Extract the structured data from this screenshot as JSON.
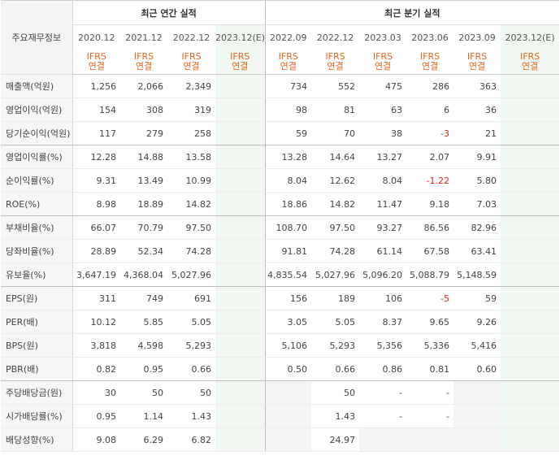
{
  "header": {
    "corner": "주요재무정보",
    "annual_title": "최근 연간 실적",
    "quarter_title": "최근 분기 실적",
    "periods": [
      "2020.12",
      "2021.12",
      "2022.12",
      "2023.12(E)",
      "2022.09",
      "2022.12",
      "2023.03",
      "2023.06",
      "2023.09",
      "2023.12(E)"
    ],
    "ifrs": "IFRS",
    "basis": "연결"
  },
  "rows": [
    {
      "label": "매출액(억원)",
      "values": [
        "1,256",
        "2,066",
        "2,349",
        "",
        "734",
        "552",
        "475",
        "286",
        "363",
        ""
      ]
    },
    {
      "label": "영업이익(억원)",
      "values": [
        "154",
        "308",
        "319",
        "",
        "98",
        "81",
        "63",
        "6",
        "36",
        ""
      ]
    },
    {
      "label": "당기순이익(억원)",
      "values": [
        "117",
        "279",
        "258",
        "",
        "59",
        "70",
        "38",
        "-3",
        "21",
        ""
      ]
    },
    {
      "label": "영업이익률(%)",
      "values": [
        "12.28",
        "14.88",
        "13.58",
        "",
        "13.28",
        "14.64",
        "13.27",
        "2.07",
        "9.91",
        ""
      ]
    },
    {
      "label": "순이익률(%)",
      "values": [
        "9.31",
        "13.49",
        "10.99",
        "",
        "8.04",
        "12.62",
        "8.04",
        "-1.22",
        "5.80",
        ""
      ]
    },
    {
      "label": "ROE(%)",
      "values": [
        "8.98",
        "18.89",
        "14.82",
        "",
        "18.86",
        "14.82",
        "11.47",
        "9.18",
        "7.03",
        ""
      ]
    },
    {
      "label": "부채비율(%)",
      "values": [
        "66.07",
        "70.79",
        "97.50",
        "",
        "108.70",
        "97.50",
        "93.27",
        "86.56",
        "82.96",
        ""
      ]
    },
    {
      "label": "당좌비율(%)",
      "values": [
        "28.89",
        "52.34",
        "74.28",
        "",
        "91.81",
        "74.28",
        "61.14",
        "67.58",
        "63.41",
        ""
      ]
    },
    {
      "label": "유보율(%)",
      "values": [
        "3,647.19",
        "4,368.04",
        "5,027.96",
        "",
        "4,835.54",
        "5,027.96",
        "5,096.20",
        "5,088.79",
        "5,148.59",
        ""
      ]
    },
    {
      "label": "EPS(원)",
      "values": [
        "311",
        "749",
        "691",
        "",
        "156",
        "189",
        "106",
        "-5",
        "59",
        ""
      ]
    },
    {
      "label": "PER(배)",
      "values": [
        "10.12",
        "5.85",
        "5.05",
        "",
        "3.05",
        "5.05",
        "8.37",
        "9.65",
        "9.26",
        ""
      ]
    },
    {
      "label": "BPS(원)",
      "values": [
        "3,818",
        "4,598",
        "5,293",
        "",
        "5,106",
        "5,293",
        "5,356",
        "5,336",
        "5,416",
        ""
      ]
    },
    {
      "label": "PBR(배)",
      "values": [
        "0.82",
        "0.95",
        "0.66",
        "",
        "0.50",
        "0.66",
        "0.86",
        "0.81",
        "0.60",
        ""
      ]
    },
    {
      "label": "주당배당금(원)",
      "values": [
        "30",
        "50",
        "50",
        "",
        "",
        "50",
        "-",
        "-",
        "",
        ""
      ]
    },
    {
      "label": "시가배당률(%)",
      "values": [
        "0.95",
        "1.14",
        "1.43",
        "",
        "",
        "1.43",
        "-",
        "-",
        "",
        ""
      ]
    },
    {
      "label": "배당성향(%)",
      "values": [
        "9.08",
        "6.29",
        "6.82",
        "",
        "",
        "24.97",
        "",
        "",
        "",
        ""
      ]
    }
  ]
}
